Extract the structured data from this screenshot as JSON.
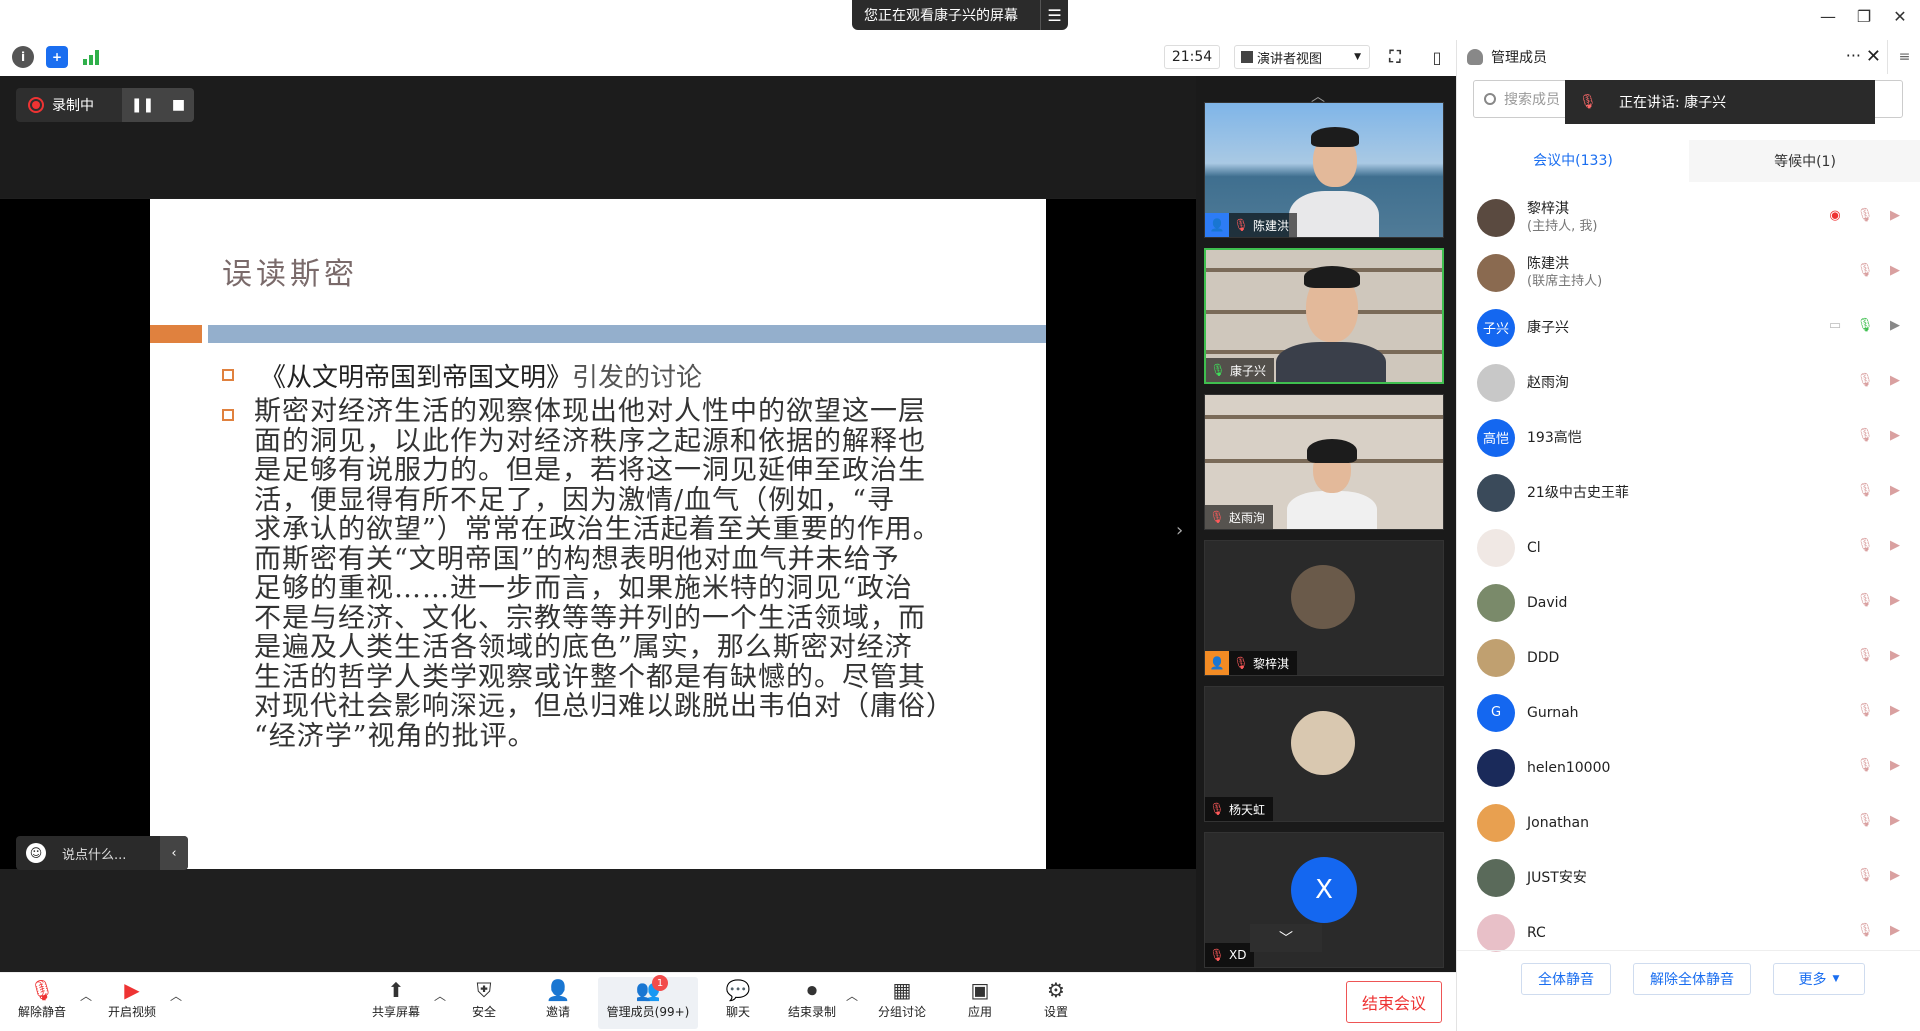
{
  "window": {
    "share_banner": "您正在观看康子兴的屏幕",
    "minimize": "—",
    "restore": "❐",
    "close": "✕"
  },
  "toolbar": {
    "clock": "21:54",
    "view_label": "演讲者视图"
  },
  "recording": {
    "label": "录制中"
  },
  "slide": {
    "title": "误读斯密",
    "bullet1_main": "《从文明帝国到帝国文明》",
    "bullet1_sub": "引发的讨论",
    "body_lines": [
      "斯密对经济生活的观察体现出他对人性中的欲望这一层",
      "面的洞见，以此作为对经济秩序之起源和依据的解释也",
      "是足够有说服力的。但是，若将这一洞见延伸至政治生",
      "活，便显得有所不足了，因为激情/血气（例如，“寻",
      "求承认的欲望”）常常在政治生活起着至关重要的作用。",
      "而斯密有关“文明帝国”的构想表明他对血气并未给予",
      "足够的重视……进一步而言，如果施米特的洞见“政治",
      "不是与经济、文化、宗教等等并列的一个生活领域，而",
      "是遍及人类生活各领域的底色”属实，那么斯密对经济",
      "生活的哲学人类学观察或许整个都是有缺憾的。尽管其",
      "对现代社会影响深远，但总归难以跳脱出韦伯对（庸俗）",
      "“经济学”视角的批评。"
    ]
  },
  "chat_input": {
    "placeholder": "说点什么..."
  },
  "thumbnails": [
    {
      "name": "陈建洪",
      "mic": "muted",
      "badge": "host-icon",
      "scene": "sky"
    },
    {
      "name": "康子兴",
      "mic": "on",
      "badge": "",
      "scene": "shelf-man"
    },
    {
      "name": "赵雨洵",
      "mic": "muted",
      "badge": "",
      "scene": "shelf-woman"
    },
    {
      "name": "黎梓淇",
      "mic": "muted",
      "badge": "user-icon",
      "scene": "avatar"
    },
    {
      "name": "杨天虹",
      "mic": "muted",
      "badge": "",
      "scene": "cat"
    },
    {
      "name": "XD",
      "mic": "muted",
      "badge": "",
      "scene": "letter",
      "letter": "X"
    }
  ],
  "panel": {
    "title": "管理成员",
    "more": "···",
    "close": "✕",
    "search_placeholder": "搜索成员",
    "speaking_label": "正在讲话: 康子兴",
    "tab_in_meeting": "会议中(133)",
    "tab_waiting": "等候中(1)",
    "participants": [
      {
        "name": "黎梓淇",
        "role": "(主持人, 我)",
        "avatar": "photo",
        "color": "#5a4a40",
        "rec": true
      },
      {
        "name": "陈建洪",
        "role": "(联席主持人)",
        "avatar": "photo",
        "color": "#8a6a50"
      },
      {
        "name": "康子兴",
        "role": "",
        "avatar": "text",
        "text": "子兴",
        "color": "#1467f0",
        "talking": true
      },
      {
        "name": "赵雨洵",
        "role": "",
        "avatar": "photo",
        "color": "#c8c8c8"
      },
      {
        "name": "193高恺",
        "role": "",
        "avatar": "text",
        "text": "高恺",
        "color": "#1467f0"
      },
      {
        "name": "21级中古史王菲",
        "role": "",
        "avatar": "photo",
        "color": "#3a4a5a"
      },
      {
        "name": "Cl",
        "role": "",
        "avatar": "photo",
        "color": "#f0e8e4"
      },
      {
        "name": "David",
        "role": "",
        "avatar": "photo",
        "color": "#7a8a6a"
      },
      {
        "name": "DDD",
        "role": "",
        "avatar": "photo",
        "color": "#c0a070"
      },
      {
        "name": "Gurnah",
        "role": "",
        "avatar": "text",
        "text": "G",
        "color": "#1467f0"
      },
      {
        "name": "helen10000",
        "role": "",
        "avatar": "photo",
        "color": "#1a2a5a"
      },
      {
        "name": "Jonathan",
        "role": "",
        "avatar": "photo",
        "color": "#e8a050"
      },
      {
        "name": "JUST安安",
        "role": "",
        "avatar": "photo",
        "color": "#5a6a5a"
      },
      {
        "name": "RC",
        "role": "",
        "avatar": "photo",
        "color": "#e8c0c8"
      }
    ],
    "btn_mute_all": "全体静音",
    "btn_unmute_all": "解除全体静音",
    "btn_more": "更多"
  },
  "bottom": {
    "unmute": "解除静音",
    "start_video": "开启视频",
    "share_screen": "共享屏幕",
    "security": "安全",
    "invite": "邀请",
    "manage_members": "管理成员(99+)",
    "members_badge": "1",
    "chat": "聊天",
    "end_recording": "结束录制",
    "breakout": "分组讨论",
    "apps": "应用",
    "settings": "设置",
    "end_meeting": "结束会议"
  }
}
